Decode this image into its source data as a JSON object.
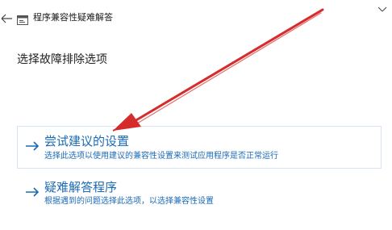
{
  "window": {
    "title": "程序兼容性疑难解答",
    "back_icon": "back-arrow-icon",
    "app_icon": "compatibility-troubleshooter-icon",
    "close_icon": "close-icon"
  },
  "main": {
    "heading": "选择故障排除选项",
    "options": [
      {
        "label": "尝试建议的设置",
        "description": "选择此选项以使用建议的兼容性设置来测试应用程序是否正常运行",
        "icon": "arrow-right-icon"
      },
      {
        "label": "疑难解答程序",
        "description": "根据遇到的问题选择此选项，以选择兼容性设置",
        "icon": "arrow-right-icon"
      }
    ]
  },
  "annotation": {
    "icon": "red-pointer-arrow",
    "color": "#d62b2b"
  },
  "colors": {
    "link": "#1b6ab5",
    "hover_border": "#d6e4f5"
  }
}
